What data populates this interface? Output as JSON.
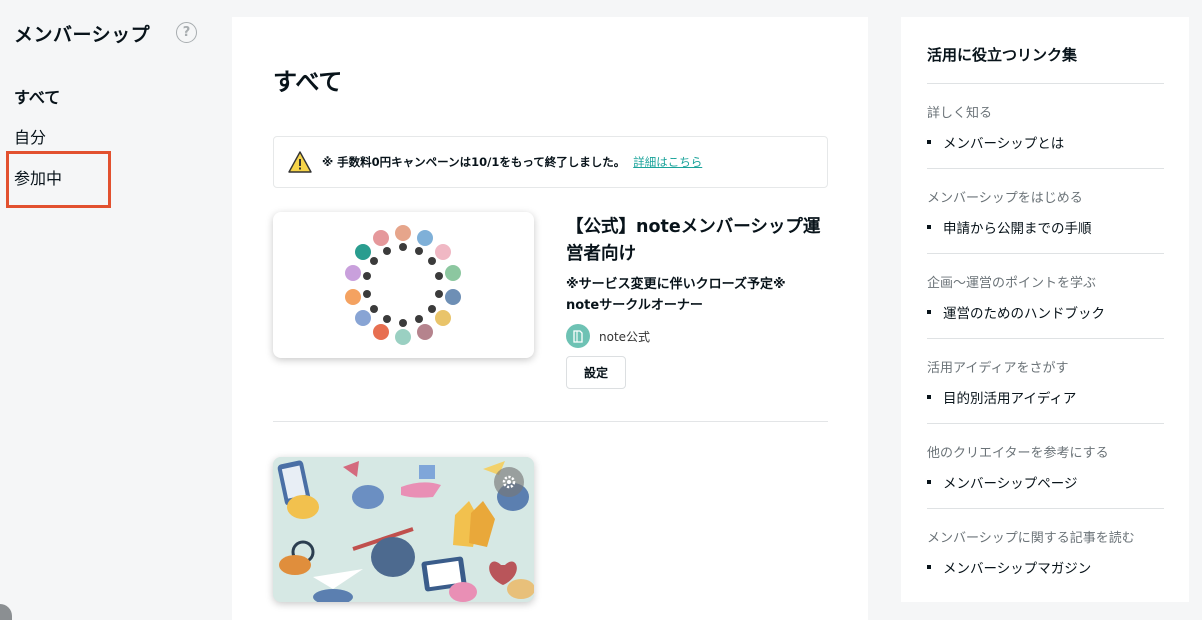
{
  "sidebar": {
    "title": "メンバーシップ",
    "help_icon": "question-circle-icon",
    "items": [
      {
        "label": "すべて",
        "active": true
      },
      {
        "label": "自分",
        "active": false
      },
      {
        "label": "参加中",
        "active": false
      }
    ]
  },
  "main": {
    "title": "すべて",
    "notice": {
      "icon": "warning-icon",
      "text": "※ 手数料0円キャンペーンは10/1をもって終了しました。",
      "link": "詳細はこちら"
    },
    "cards": [
      {
        "title": "【公式】noteメンバーシップ運営者向け",
        "description": "※サービス変更に伴いクローズ予定※\nnoteサークルオーナー",
        "owner": "note公式",
        "button": "設定"
      }
    ]
  },
  "right_panel": {
    "title": "活用に役立つリンク集",
    "sections": [
      {
        "heading": "詳しく知る",
        "link": "メンバーシップとは"
      },
      {
        "heading": "メンバーシップをはじめる",
        "link": "申請から公開までの手順"
      },
      {
        "heading": "企画〜運営のポイントを学ぶ",
        "link": "運営のためのハンドブック"
      },
      {
        "heading": "活用アイディアをさがす",
        "link": "目的別活用アイディア"
      },
      {
        "heading": "他のクリエイターを参考にする",
        "link": "メンバーシップページ"
      },
      {
        "heading": "メンバーシップに関する記事を読む",
        "link": "メンバーシップマガジン"
      }
    ]
  },
  "colors": {
    "accent": "#1aa39a",
    "highlight": "#e2512f",
    "background": "#f5f6f7"
  }
}
